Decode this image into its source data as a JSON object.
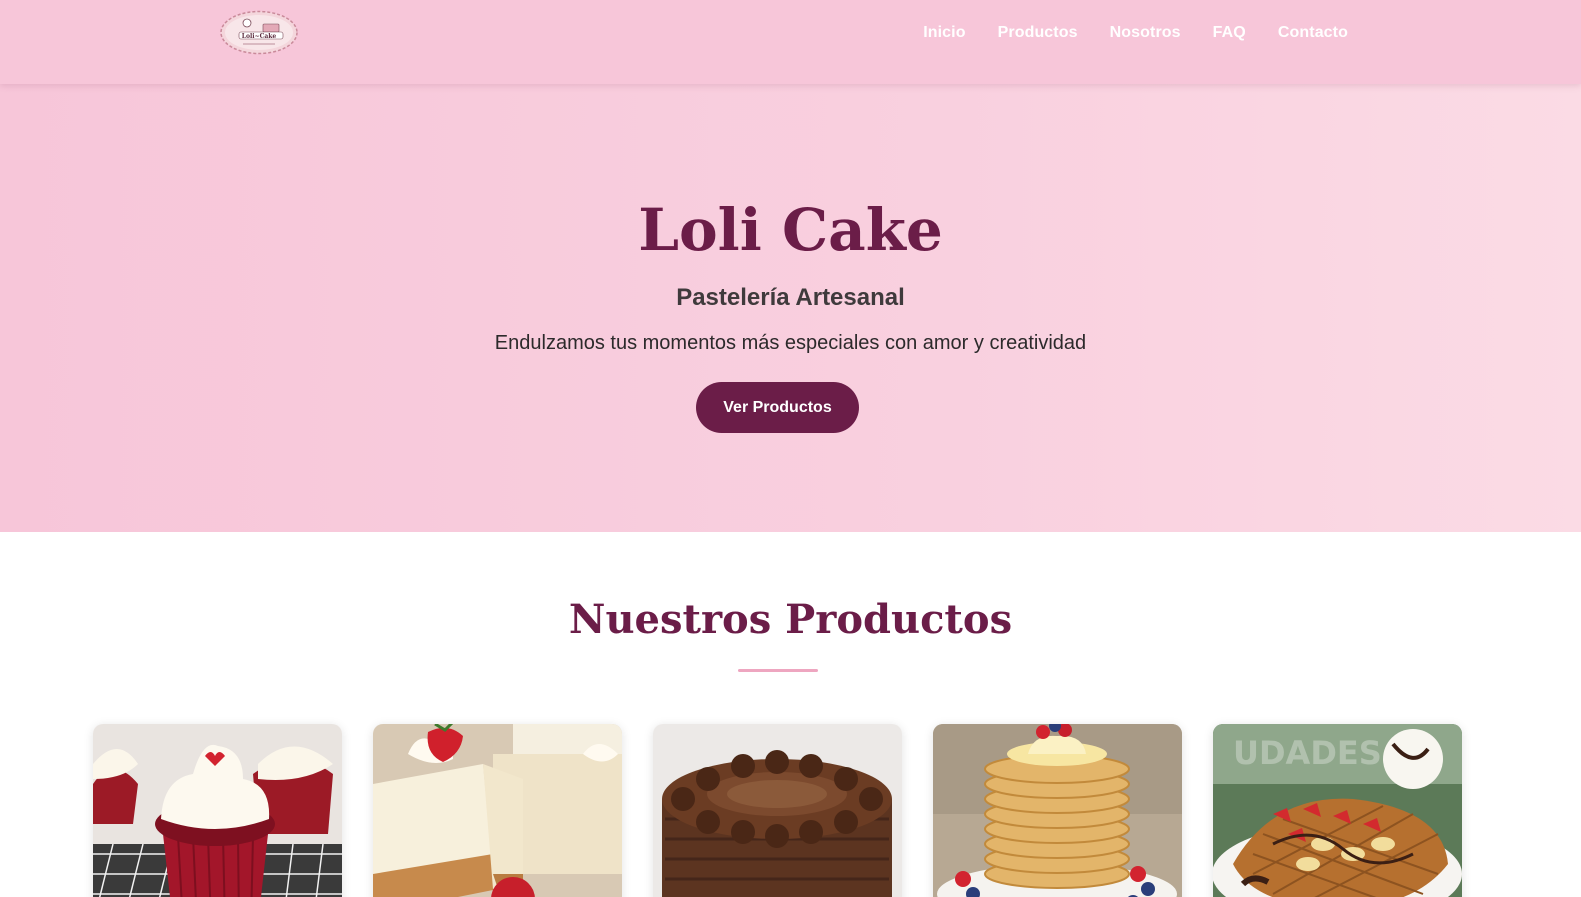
{
  "navbar": {
    "logo_text": "Loli Cake",
    "logo_tagline": "Endulzamos tus momentos",
    "links": [
      "Inicio",
      "Productos",
      "Nosotros",
      "FAQ",
      "Contacto"
    ]
  },
  "hero": {
    "title": "Loli Cake",
    "subtitle": "Pastelería Artesanal",
    "tagline": "Endulzamos tus momentos más especiales con amor y creatividad",
    "cta": "Ver Productos"
  },
  "products": {
    "title": "Nuestros Productos",
    "items": [
      {
        "image": "red-velvet-cupcake-image"
      },
      {
        "image": "cheesecake-image"
      },
      {
        "image": "chocolate-cake-image"
      },
      {
        "image": "pancakes-image"
      },
      {
        "image": "waffle-image"
      }
    ]
  },
  "colors": {
    "navbar": "#f7c6d9",
    "hero": "#f9d0df",
    "brand": "#6b1d48",
    "accent": "#eea6c0"
  }
}
